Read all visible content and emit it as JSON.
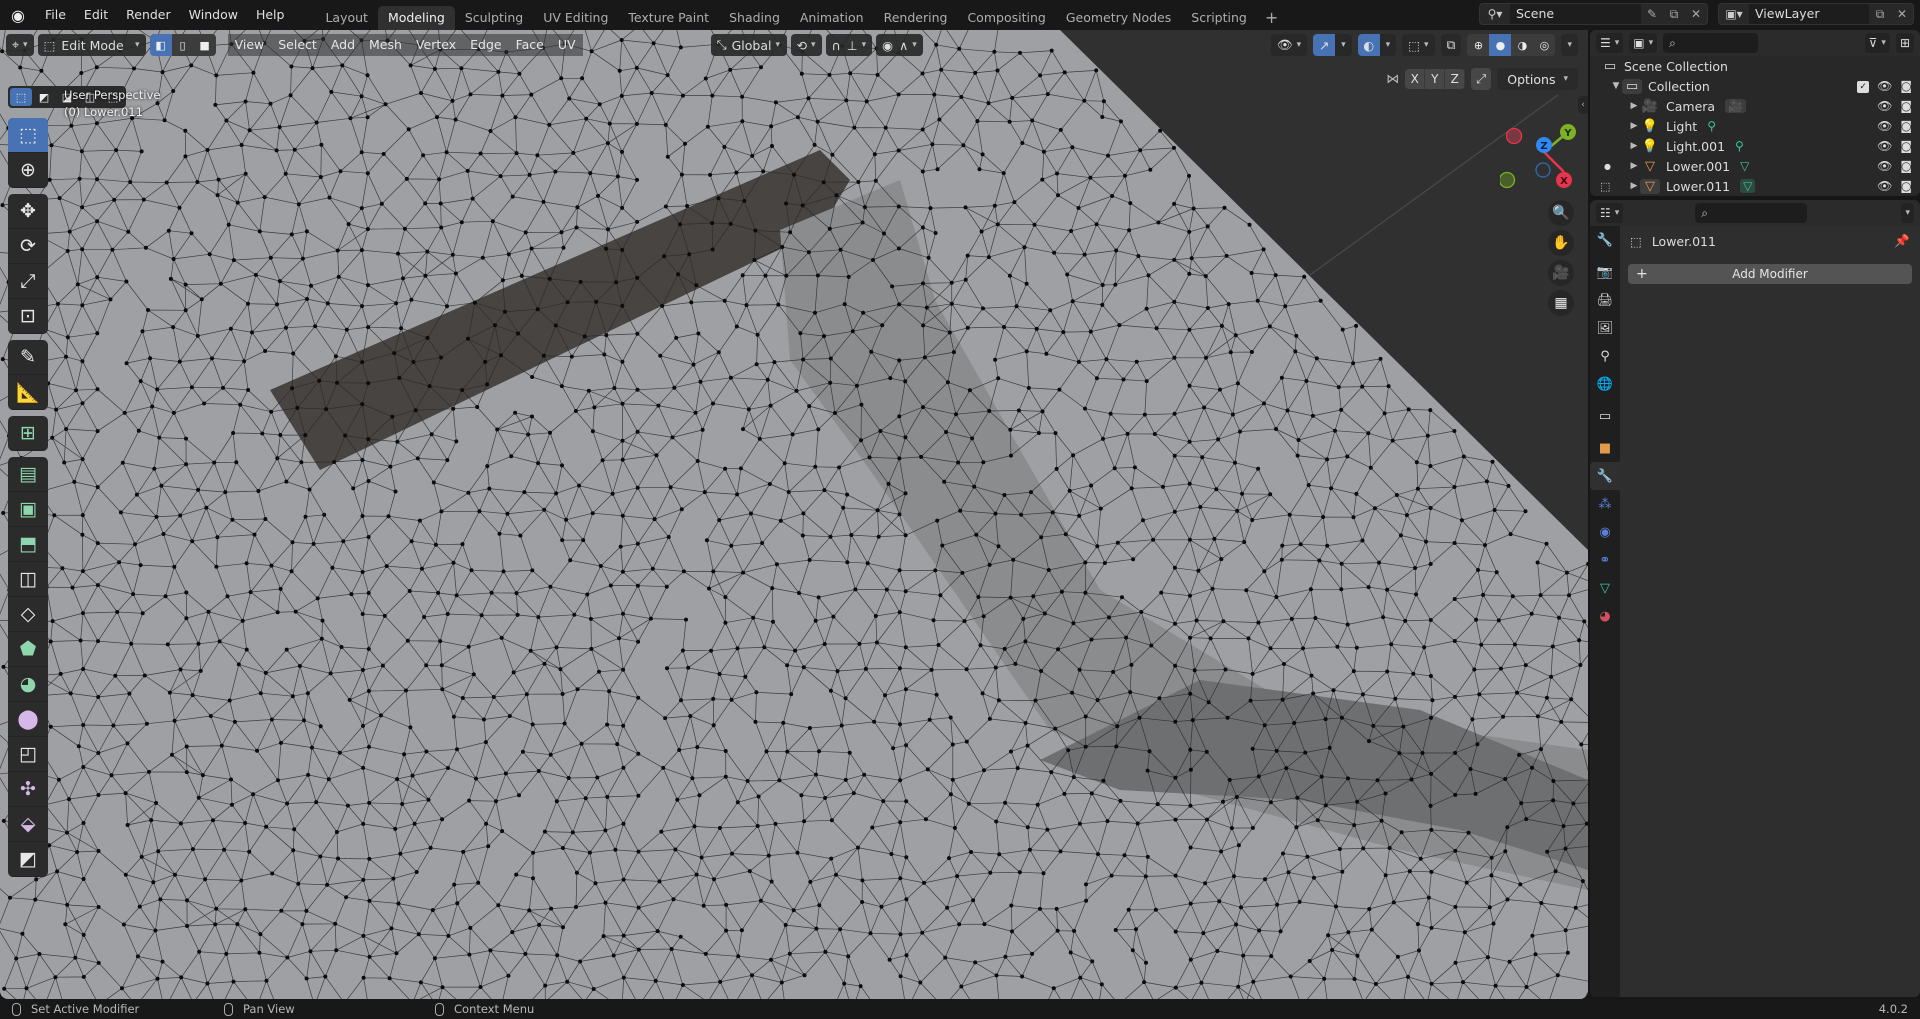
{
  "topbar": {
    "menus": [
      "File",
      "Edit",
      "Render",
      "Window",
      "Help"
    ],
    "workspaces": [
      "Layout",
      "Modeling",
      "Sculpting",
      "UV Editing",
      "Texture Paint",
      "Shading",
      "Animation",
      "Rendering",
      "Compositing",
      "Geometry Nodes",
      "Scripting"
    ],
    "active_workspace": "Modeling",
    "add_workspace": "+",
    "scene": "Scene",
    "view_layer": "ViewLayer"
  },
  "viewport": {
    "mode": "Edit Mode",
    "menus": [
      "View",
      "Select",
      "Add",
      "Mesh",
      "Vertex",
      "Edge",
      "Face",
      "UV"
    ],
    "transform_orientation": "Global",
    "info_line1": "User Perspective",
    "info_line2": "(0) Lower.011",
    "mirror_axes": [
      "X",
      "Y",
      "Z"
    ],
    "options_label": "Options",
    "gizmo": {
      "x": "X",
      "y": "Y",
      "z": "Z",
      "colors": {
        "x": "#e8344c",
        "y": "#7db322",
        "z": "#2f89f5"
      }
    },
    "mesh_color": "#9ea0a3",
    "background": "#303030"
  },
  "outliner": {
    "search_placeholder": "",
    "root": "Scene Collection",
    "collection": "Collection",
    "objects": [
      {
        "name": "Camera",
        "type": "camera"
      },
      {
        "name": "Light",
        "type": "light"
      },
      {
        "name": "Light.001",
        "type": "light"
      },
      {
        "name": "Lower.001",
        "type": "mesh"
      },
      {
        "name": "Lower.011",
        "type": "mesh"
      }
    ]
  },
  "properties": {
    "object_name": "Lower.011",
    "add_modifier_label": "Add Modifier",
    "tabs": [
      "tool",
      "render",
      "output",
      "view-layer",
      "scene",
      "world",
      "collection",
      "object",
      "modifiers",
      "particles",
      "physics",
      "constraints",
      "data",
      "material"
    ],
    "active_tab": "modifiers"
  },
  "statusbar": {
    "left_action": "Set Active Modifier",
    "middle_action": "Pan View",
    "right_action": "Context Menu",
    "version": "4.0.2"
  },
  "accent_color": "#4772b3"
}
